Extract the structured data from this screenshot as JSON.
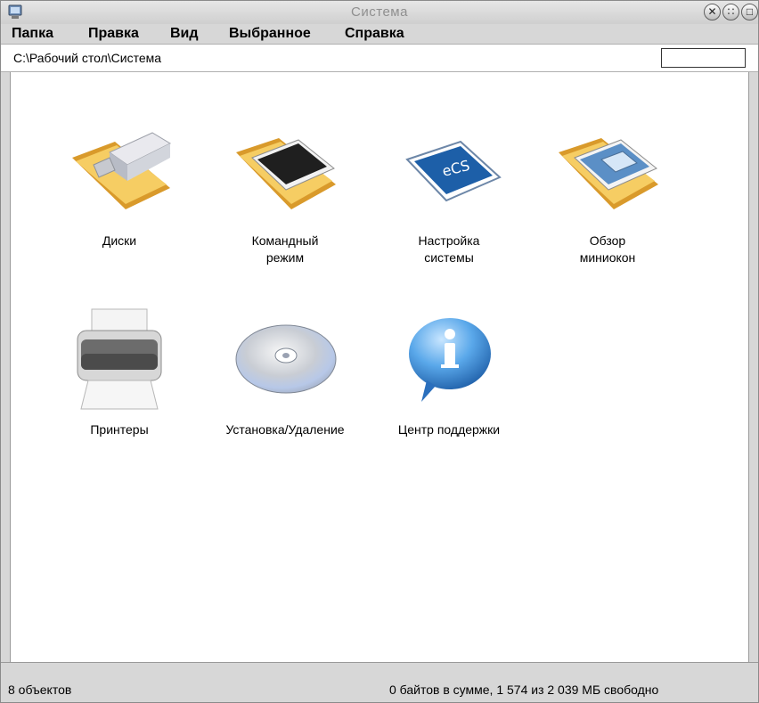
{
  "window": {
    "title": "Система"
  },
  "menu": [
    {
      "label": "Папка"
    },
    {
      "label": "Правка"
    },
    {
      "label": "Вид"
    },
    {
      "label": "Выбранное"
    },
    {
      "label": "Справка"
    }
  ],
  "address": {
    "path": "C:\\Рабочий стол\\Система",
    "search_value": ""
  },
  "items": [
    {
      "label": "Диски",
      "icon": "usb-drive-folder-icon"
    },
    {
      "label": "Командный\nрежим",
      "icon": "command-prompt-folder-icon"
    },
    {
      "label": "Настройка\nсистемы",
      "icon": "ecs-settings-icon"
    },
    {
      "label": "Обзор\nминиокон",
      "icon": "mini-windows-folder-icon"
    },
    {
      "label": "Принтеры",
      "icon": "printer-icon"
    },
    {
      "label": "Установка/Удаление",
      "icon": "cd-disc-icon"
    },
    {
      "label": "Центр поддержки",
      "icon": "info-bubble-icon"
    }
  ],
  "status": {
    "count": "8 объектов",
    "summary": "0 байтов в сумме, 1 574 из 2 039 МБ свободно"
  },
  "colors": {
    "folder": "#f2c24f",
    "ecs_blue": "#1d5fa8",
    "info_blue": "#2f86d6"
  }
}
